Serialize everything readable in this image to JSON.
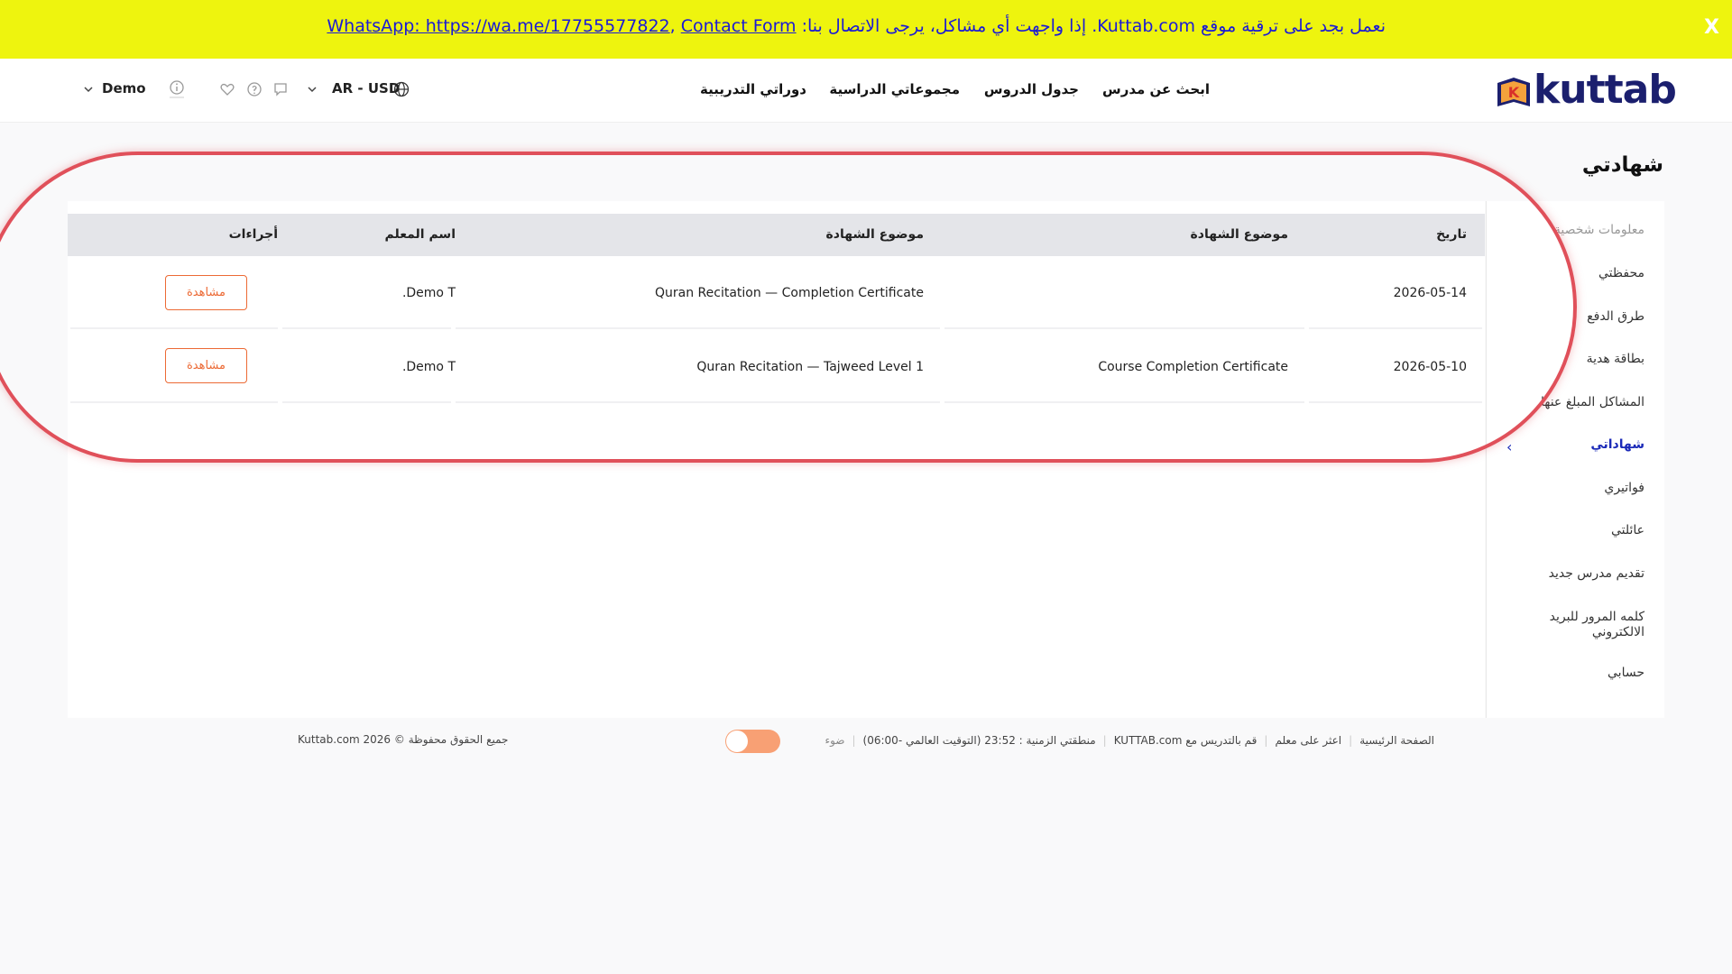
{
  "banner": {
    "text": "نعمل بجد على ترقية موقع Kuttab.com. إذا واجهت أي مشاكل، يرجى الاتصال بنا:",
    "link_whatsapp": "WhatsApp: https://wa.me/17755577822",
    "separator": ", ",
    "link_contact": "Contact Form",
    "close": "X"
  },
  "header": {
    "logo": "kuttab",
    "logo_letter": "K",
    "nav": [
      "ابحث عن مدرس",
      "جدول الدروس",
      "مجموعاتي الدراسية",
      "دوراتي التدريبية"
    ],
    "locale": "AR - USD",
    "user": "Demo"
  },
  "page": {
    "title": "شهادتي"
  },
  "sidebar": {
    "items": [
      "معلومات شخصية",
      "محفظتي",
      "طرق الدفع",
      "بطاقة هدية",
      "المشاكل المبلغ عنها",
      "شهاداتي",
      "فواتيري",
      "عائلتي",
      "تقديم مدرس جديد",
      "كلمه المرور للبريد الالكتروني",
      "حسابي"
    ],
    "active_index": 5
  },
  "table": {
    "headers": [
      "تاريخ",
      "موضوع الشهادة",
      "موضوع الشهادة",
      "اسم المعلم",
      "أجراءات"
    ],
    "rows": [
      {
        "date": "2026-05-14",
        "subject1": "",
        "subject2": "Quran Recitation — Completion Certificate",
        "teacher": "Demo T.",
        "action": "مشاهدة"
      },
      {
        "date": "2026-05-10",
        "subject1": "Course Completion Certificate",
        "subject2": "Quran Recitation — Tajweed Level 1",
        "teacher": "Demo T.",
        "action": "مشاهدة"
      }
    ]
  },
  "footer": {
    "links": [
      "الصفحة الرئيسية",
      "اعثر على معلم",
      "قم بالتدريس مع KUTTAB.com"
    ],
    "timezone": "منطقتي الزمنية : 23:52 (التوقيت العالمي -06:00)",
    "light_label": "ضوء",
    "copyright": "جميع الحقوق محفوظة © 2026 Kuttab.com"
  },
  "colors": {
    "banner": "#eef40e",
    "accent": "#ec6a35",
    "brand": "#1b1f6e",
    "active": "#1b2ab8",
    "highlight": "#e0505a"
  }
}
